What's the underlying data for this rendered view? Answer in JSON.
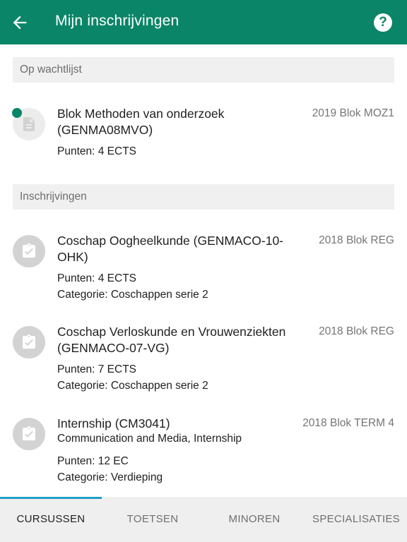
{
  "app_bar": {
    "title": "Mijn inschrijvingen",
    "back_icon": "arrow-left-icon",
    "help_icon": "help-circle-icon",
    "help_glyph": "?",
    "color": "#0b8568"
  },
  "sections": {
    "waitlist": {
      "header": "Op wachtlijst",
      "items": [
        {
          "icon": "document-icon",
          "status_dot_color": "#0b8568",
          "name": "Blok Methoden van onderzoek (GENMA08MVO)",
          "period": "2019 Blok MOZ1",
          "points": "Punten: 4 ECTS"
        }
      ]
    },
    "enrollments": {
      "header": "Inschrijvingen",
      "items": [
        {
          "icon": "clipboard-check-icon",
          "name": "Coschap Oogheelkunde (GENMACO-10-OHK)",
          "period": "2018 Blok REG",
          "points": "Punten: 4 ECTS",
          "category": "Categorie: Coschappen serie 2"
        },
        {
          "icon": "clipboard-check-icon",
          "name": "Coschap Verloskunde en Vrouwenziekten (GENMACO-07-VG)",
          "period": "2018 Blok REG",
          "points": "Punten: 7 ECTS",
          "category": "Categorie: Coschappen serie 2"
        },
        {
          "icon": "clipboard-check-icon",
          "name": "Internship (CM3041)",
          "subtitle": "Communication and Media, Internship",
          "period": "2018 Blok TERM 4",
          "points": "Punten: 12 EC",
          "category": "Categorie: Verdieping"
        }
      ]
    }
  },
  "tabs": [
    {
      "label": "CURSUSSEN",
      "active": true
    },
    {
      "label": "TOETSEN",
      "active": false
    },
    {
      "label": "MINOREN",
      "active": false
    },
    {
      "label": "SPECIALISATIES",
      "active": false
    }
  ],
  "colors": {
    "accent": "#0b8568",
    "tab_indicator": "#1e9fc6"
  }
}
